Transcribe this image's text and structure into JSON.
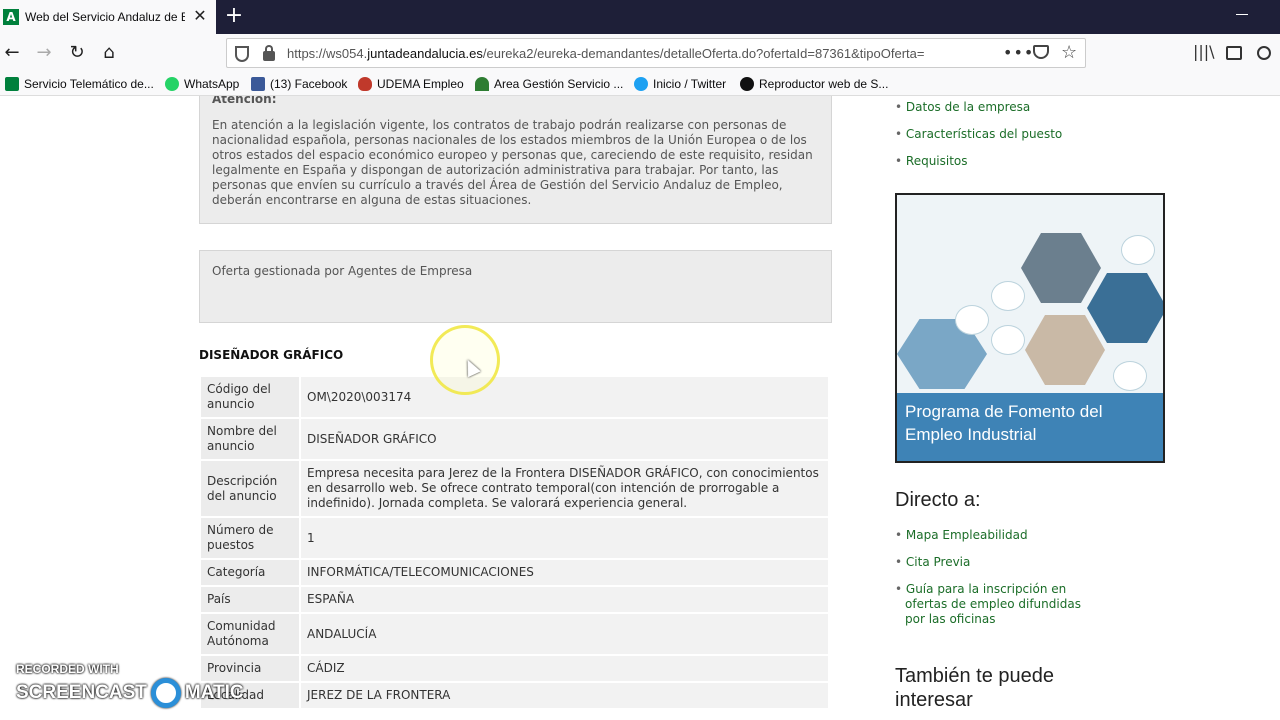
{
  "browser": {
    "tab_title": "Web del Servicio Andaluz de Em",
    "tab_favicon": "A",
    "new_tab": "+",
    "url_prefix": "https://ws054.",
    "url_domain": "juntadeandalucia.es",
    "url_path": "/eureka2/eureka-demandantes/detalleOferta.do?ofertaId=87361&tipoOferta=",
    "url_more": "•••"
  },
  "bookmarks": [
    {
      "label": "Servicio Telemático de...",
      "icon": "andalucia-icon",
      "color": "#00803c"
    },
    {
      "label": "WhatsApp",
      "icon": "whatsapp-icon",
      "color": "#25d366"
    },
    {
      "label": "(13) Facebook",
      "icon": "facebook-icon",
      "color": "#3b5998"
    },
    {
      "label": "UDEMA Empleo",
      "icon": "udema-icon",
      "color": "#c0392b"
    },
    {
      "label": "Area Gestión Servicio ...",
      "icon": "area-gestion-icon",
      "color": "#2e7d32"
    },
    {
      "label": "Inicio / Twitter",
      "icon": "twitter-icon",
      "color": "#1da1f2"
    },
    {
      "label": "Reproductor web de S...",
      "icon": "spotify-icon",
      "color": "#111111"
    }
  ],
  "notice": {
    "heading": "Atención:",
    "text": "En atención a la legislación vigente, los contratos de trabajo podrán realizarse con personas de nacionalidad española, personas nacionales de los estados miembros de la Unión Europea o de los otros estados del espacio económico europeo y personas que, careciendo de este requisito, residan legalmente en España y dispongan de autorización administrativa para trabajar. Por tanto, las personas que envíen su currículo a través del Área de Gestión del Servicio Andaluz de Empleo, deberán encontrarse en alguna de estas situaciones."
  },
  "managed_by": "Oferta gestionada por Agentes de Empresa",
  "job_title": "DISEÑADOR GRÁFICO",
  "details": [
    {
      "label": "Código del anuncio",
      "value": "OM\\2020\\003174"
    },
    {
      "label": "Nombre del anuncio",
      "value": "DISEÑADOR GRÁFICO"
    },
    {
      "label": "Descripción del anuncio",
      "value": "Empresa necesita para Jerez de la Frontera DISEÑADOR GRÁFICO, con conocimientos en desarrollo web. Se ofrece contrato temporal(con intención de prorrogable a indefinido). Jornada completa. Se valorará experiencia general."
    },
    {
      "label": "Número de puestos",
      "value": "1"
    },
    {
      "label": "Categoría",
      "value": "INFORMÁTICA/TELECOMUNICACIONES"
    },
    {
      "label": "País",
      "value": "ESPAÑA"
    },
    {
      "label": "Comunidad Autónoma",
      "value": "ANDALUCÍA"
    },
    {
      "label": "Provincia",
      "value": "CÁDIZ"
    },
    {
      "label": "Localidad",
      "value": "JEREZ DE LA FRONTERA"
    }
  ],
  "sidebar": {
    "section_links": [
      "Datos de la empresa",
      "Características del puesto",
      "Requisitos"
    ],
    "promo_caption": "Programa de Fomento del Empleo Industrial",
    "direct_heading": "Directo a:",
    "direct_links": [
      "Mapa Empleabilidad",
      "Cita Previa",
      "Guía para la inscripción en ofertas de empleo difundidas por las oficinas"
    ],
    "also_heading": "También te puede interesar"
  },
  "watermark": {
    "line1": "RECORDED WITH",
    "line2a": "SCREENCAST",
    "line2b": "MATIC"
  }
}
